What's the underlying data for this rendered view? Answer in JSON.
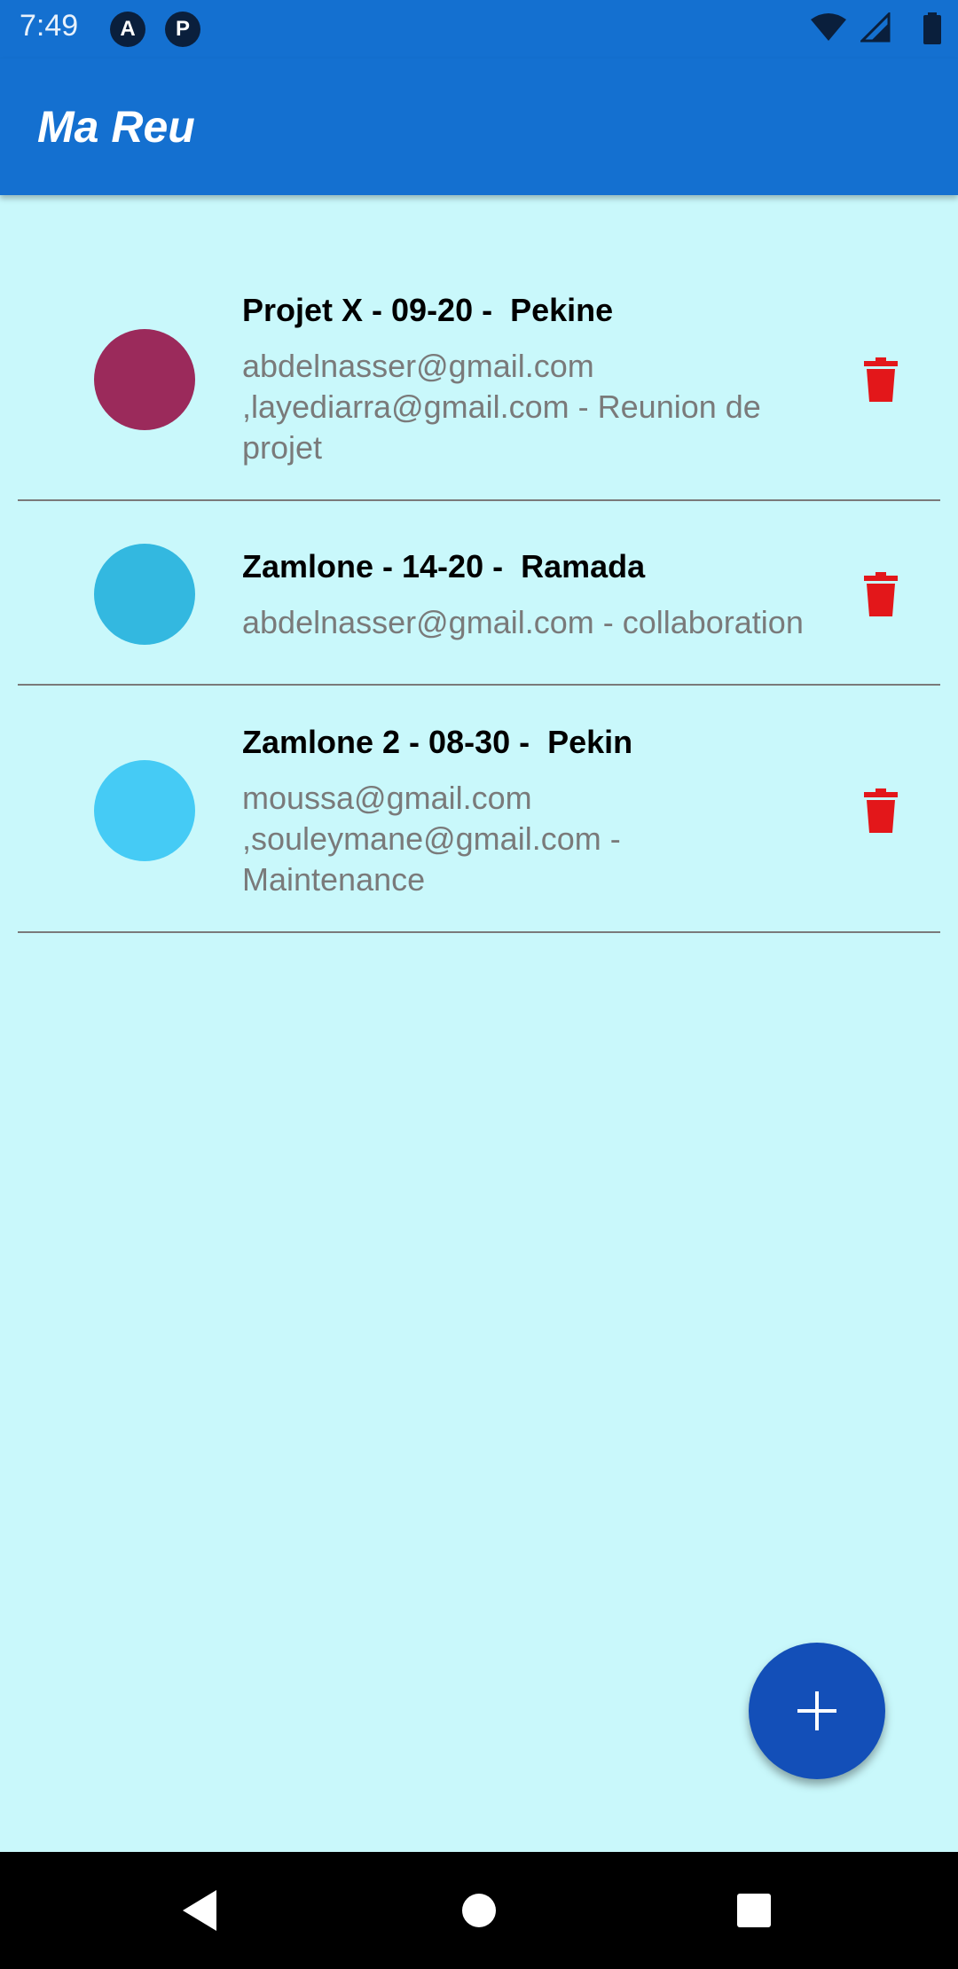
{
  "status_bar": {
    "time": "7:49",
    "notification_icons": [
      "A",
      "P"
    ]
  },
  "app_bar": {
    "title": "Ma Reu"
  },
  "meetings": [
    {
      "title": "Projet X - 09-20 -  Pekine",
      "description": "abdelnasser@gmail.com\n,layediarra@gmail.com - Reunion de\nprojet",
      "color": "#9b2a5b"
    },
    {
      "title": "Zamlone - 14-20 -  Ramada",
      "description": "abdelnasser@gmail.com - collaboration",
      "color": "#33b8e0"
    },
    {
      "title": "Zamlone 2 - 08-30 -  Pekin",
      "description": "moussa@gmail.com\n,souleymane@gmail.com -\nMaintenance",
      "color": "#45cbf5"
    }
  ],
  "colors": {
    "primary": "#1470d0",
    "background": "#c9f8fb",
    "fab": "#134fb8",
    "delete": "#e3171a"
  },
  "icons": {
    "delete": "trash-icon",
    "add": "plus-icon",
    "nav": [
      "back-icon",
      "home-icon",
      "recents-icon"
    ]
  }
}
